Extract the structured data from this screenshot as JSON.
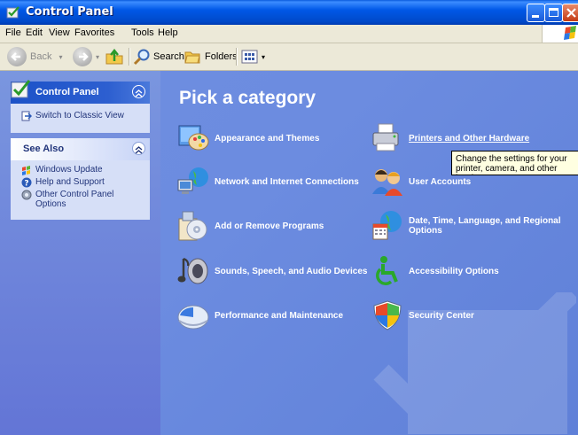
{
  "window": {
    "title": "Control Panel"
  },
  "menubar": {
    "items": [
      "File",
      "Edit",
      "View",
      "Favorites",
      "Tools",
      "Help"
    ]
  },
  "toolbar": {
    "back": "Back",
    "search": "Search",
    "folders": "Folders"
  },
  "leftpane": {
    "control_panel": {
      "title": "Control Panel",
      "switch_view": "Switch to Classic View"
    },
    "see_also": {
      "title": "See Also",
      "items": [
        "Windows Update",
        "Help and Support",
        "Other Control Panel Options"
      ]
    }
  },
  "main": {
    "heading": "Pick a category",
    "categories": [
      "Appearance and Themes",
      "Printers and Other Hardware",
      "Network and Internet Connections",
      "User Accounts",
      "Add or Remove Programs",
      "Date, Time, Language, and Regional Options",
      "Sounds, Speech, and Audio Devices",
      "Accessibility Options",
      "Performance and Maintenance",
      "Security Center"
    ],
    "tooltip": "Change the settings for your printer, camera, and other hardware."
  },
  "colors": {
    "title_bar": "#0058e7",
    "content_bg": "#6e8ee0",
    "link_text": "#21347a",
    "tooltip_bg": "#ffffe1"
  },
  "icons": [
    "control-panel-icon",
    "windows-update-icon",
    "help-icon",
    "options-icon",
    "appearance-icon",
    "printer-icon",
    "network-icon",
    "user-accounts-icon",
    "add-remove-programs-icon",
    "date-time-icon",
    "sounds-icon",
    "accessibility-icon",
    "performance-icon",
    "security-center-icon"
  ]
}
